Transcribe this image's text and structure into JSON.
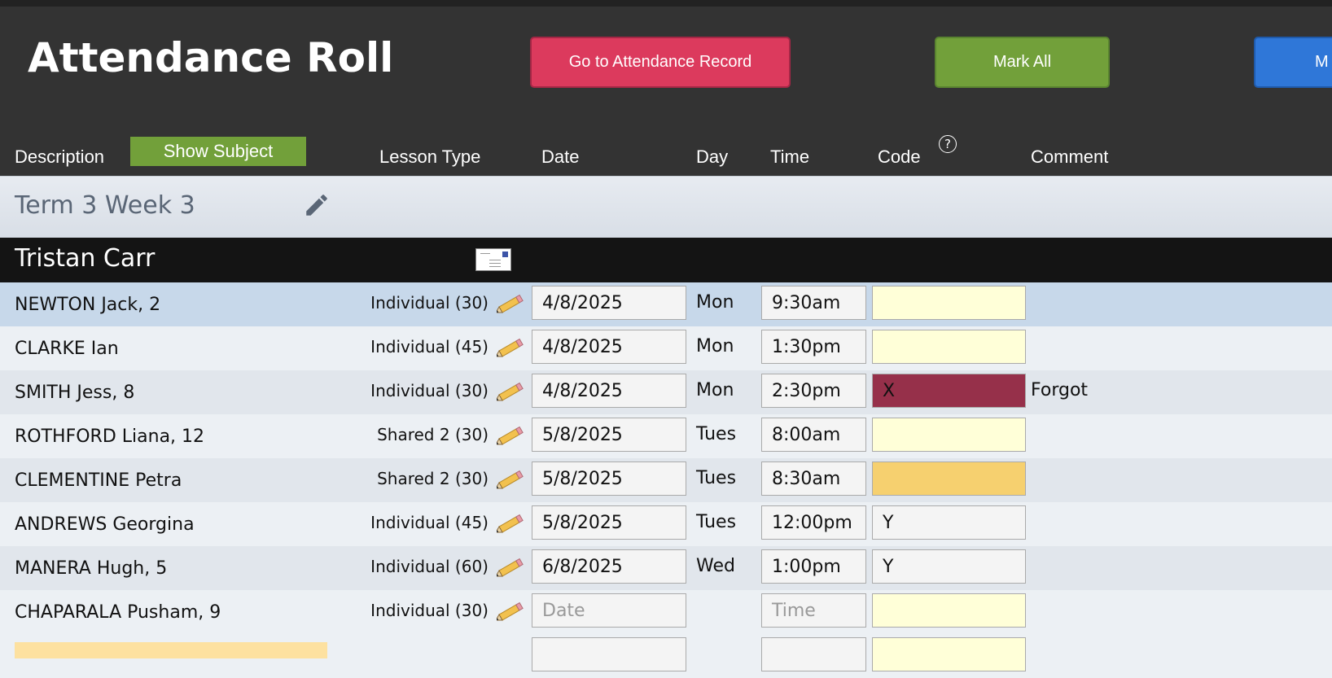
{
  "header": {
    "title": "Attendance Roll",
    "btn_record": "Go to Attendance Record",
    "btn_mark_all": "Mark All",
    "btn_more": "M"
  },
  "columns": {
    "description": "Description",
    "show_subject": "Show Subject",
    "lesson_type": "Lesson Type",
    "date": "Date",
    "day": "Day",
    "time": "Time",
    "code": "Code",
    "help": "?",
    "comment": "Comment"
  },
  "term": {
    "label": "Term 3 Week 3"
  },
  "teacher": {
    "name": "Tristan Carr"
  },
  "placeholders": {
    "date": "Date",
    "time": "Time"
  },
  "rows": [
    {
      "student": "NEWTON Jack, 2",
      "lesson": "Individual (30)",
      "date": "4/8/2025",
      "day": "Mon",
      "time": "9:30am",
      "code": "",
      "comment": "",
      "code_color": "#ffffd8"
    },
    {
      "student": "CLARKE Ian",
      "lesson": "Individual (45)",
      "date": "4/8/2025",
      "day": "Mon",
      "time": "1:30pm",
      "code": "",
      "comment": "",
      "code_color": "#ffffd8"
    },
    {
      "student": "SMITH Jess, 8",
      "lesson": "Individual (30)",
      "date": "4/8/2025",
      "day": "Mon",
      "time": "2:30pm",
      "code": "X",
      "comment": "Forgot",
      "code_color": "#96304a"
    },
    {
      "student": "ROTHFORD Liana, 12",
      "lesson": "Shared 2 (30)",
      "date": "5/8/2025",
      "day": "Tues",
      "time": "8:00am",
      "code": "",
      "comment": "",
      "code_color": "#ffffd8"
    },
    {
      "student": "CLEMENTINE Petra",
      "lesson": "Shared 2 (30)",
      "date": "5/8/2025",
      "day": "Tues",
      "time": "8:30am",
      "code": "",
      "comment": "",
      "code_color": "#f6d06f"
    },
    {
      "student": "ANDREWS Georgina",
      "lesson": "Individual (45)",
      "date": "5/8/2025",
      "day": "Tues",
      "time": "12:00pm",
      "code": "Y",
      "comment": "",
      "code_color": "#f4f4f4"
    },
    {
      "student": "MANERA Hugh, 5",
      "lesson": "Individual (60)",
      "date": "6/8/2025",
      "day": "Wed",
      "time": "1:00pm",
      "code": "Y",
      "comment": "",
      "code_color": "#f4f4f4"
    },
    {
      "student": "CHAPARALA Pusham, 9",
      "lesson": "Individual (30)",
      "date": "",
      "day": "",
      "time": "",
      "code": "",
      "comment": "",
      "code_color": "#ffffd8"
    }
  ],
  "colors": {
    "header_bg": "#333333",
    "record_button": "#dc3a5d",
    "mark_all_button": "#72a03a",
    "more_button": "#2f77d8",
    "selected_row": "#c7d8ea"
  }
}
